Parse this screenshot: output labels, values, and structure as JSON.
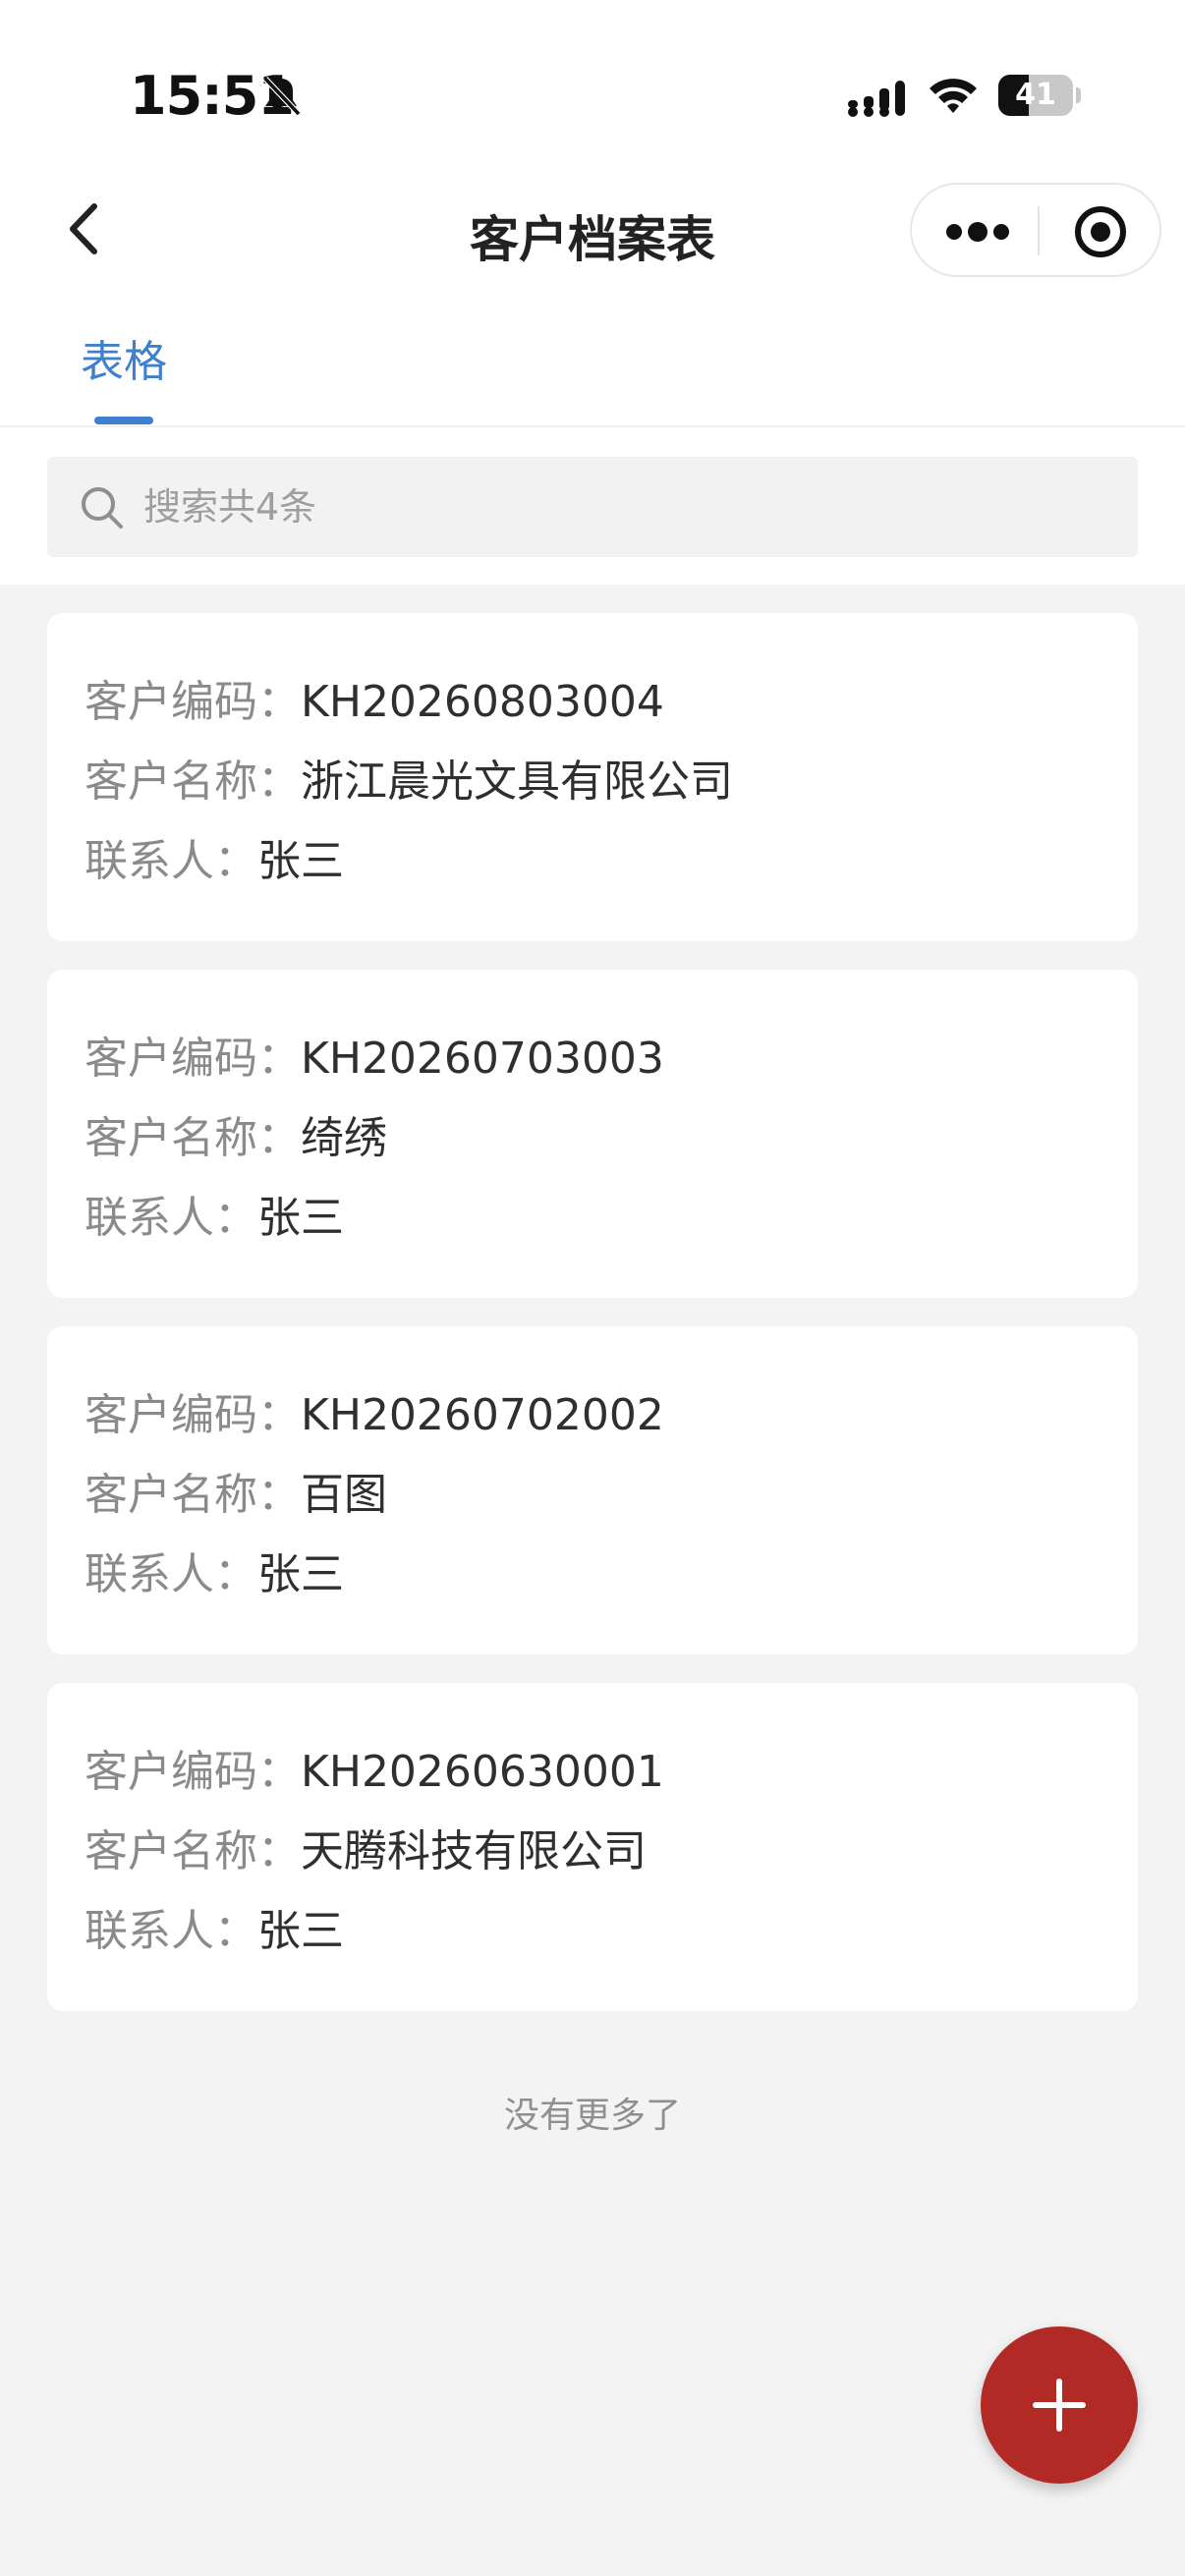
{
  "status_bar": {
    "time": "15:51",
    "battery_level": "41",
    "battery_fraction": 0.41
  },
  "nav": {
    "title": "客户档案表"
  },
  "tabs": [
    {
      "label": "表格",
      "active": true
    }
  ],
  "search": {
    "placeholder": "搜索共4条",
    "value": ""
  },
  "labels": {
    "code": "客户编码：",
    "name": "客户名称：",
    "contact": "联系人："
  },
  "customers": [
    {
      "code": "KH20260803004",
      "name": "浙江晨光文具有限公司",
      "contact": "张三"
    },
    {
      "code": "KH20260703003",
      "name": "绮绣",
      "contact": "张三"
    },
    {
      "code": "KH20260702002",
      "name": "百图",
      "contact": "张三"
    },
    {
      "code": "KH20260630001",
      "name": "天腾科技有限公司",
      "contact": "张三"
    }
  ],
  "footer": {
    "no_more": "没有更多了"
  },
  "colors": {
    "accent": "#3e7fd0",
    "fab": "#b22a26",
    "background": "#f3f3f3"
  },
  "icons": {
    "back": "chevron-left-icon",
    "more": "more-dots-icon",
    "target": "target-circle-icon",
    "search": "search-icon",
    "add": "plus-icon"
  }
}
